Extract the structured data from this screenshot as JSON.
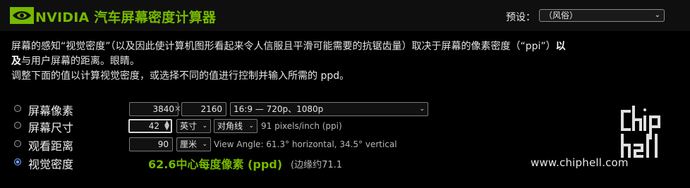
{
  "header": {
    "logo_icon": "nvidia-eye-icon",
    "title": "NVIDIA 汽车屏幕密度计算器",
    "preset_label": "预设：",
    "preset_value": "（风俗）"
  },
  "intro": {
    "line1": "屏幕的感知“视觉密度”（以及因此使计算机图形看起来令人信服且平滑可能需要的抗锯齿量）取决于屏幕的像素密度（“ppi”）",
    "line1_bold": "以",
    "line2_bold": "及",
    "line2": "与用户屏幕的距离。眼睛。",
    "line3": "调整下面的值以计算视觉密度，或选择不同的值进行控制并输入所需的 ppd。"
  },
  "rows": {
    "pixels": {
      "label": "屏幕像素",
      "width": "3840",
      "times": "×",
      "height": "2160",
      "aspect": "16:9 — 720p、1080p"
    },
    "size": {
      "label": "屏幕尺寸",
      "value": "42",
      "unit": "英寸",
      "measure": "对角线",
      "ppi_text": "91 pixels/inch (ppi)"
    },
    "distance": {
      "label": "观看距离",
      "value": "90",
      "unit": "厘米",
      "view_text": "View Angle: 61.3° horizontal, 34.5° vertical"
    },
    "density": {
      "label": "视觉密度",
      "ppd_value": "62.6",
      "ppd_label": "中心每度像素 (ppd)",
      "edge_text": "(边缘约71.1"
    }
  },
  "watermark": {
    "text": "chiphell",
    "url": "www.chiphell.com"
  },
  "colors": {
    "accent": "#76b900",
    "background": "#000000",
    "radio_selected": "#7aa7ff"
  }
}
